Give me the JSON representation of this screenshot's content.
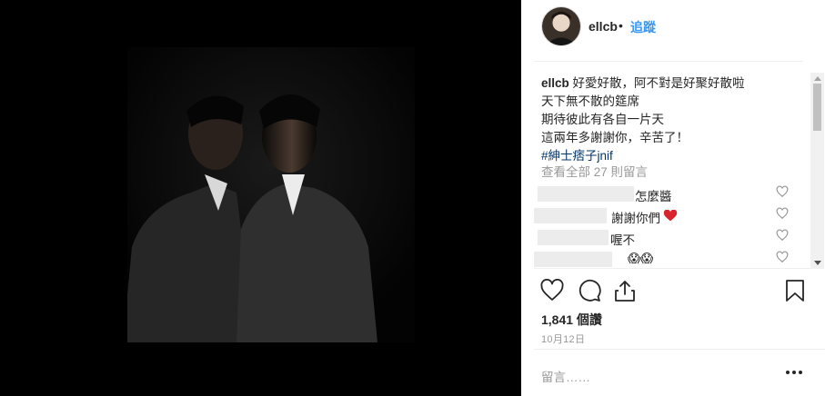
{
  "post": {
    "username": "ellcb",
    "separator": "•",
    "follow_label": "追蹤"
  },
  "caption": {
    "username": "ellcb",
    "first_line": "好愛好散，阿不對是好聚好散啦",
    "lines": [
      "天下無不散的筵席",
      "期待彼此有各自一片天",
      "這兩年多謝謝你，辛苦了！"
    ],
    "hashtag": "#紳士痞子jnif"
  },
  "view_all_comments": "查看全部 27 則留言",
  "comments": [
    {
      "text": "怎麼醬"
    },
    {
      "text": "謝謝你們"
    },
    {
      "text": "喔不"
    },
    {
      "text": "😱😱"
    }
  ],
  "likes": "1,841 個讚",
  "date": "10月12日",
  "add_comment_placeholder": "留言……",
  "icons": {
    "like": "heart-icon",
    "comment": "comment-bubble-icon",
    "share": "share-icon",
    "save": "bookmark-icon",
    "more": "more-options-icon",
    "comment_like": "small-heart-icon"
  },
  "colors": {
    "link": "#3897f0",
    "hashtag": "#003569",
    "muted": "#999999"
  }
}
